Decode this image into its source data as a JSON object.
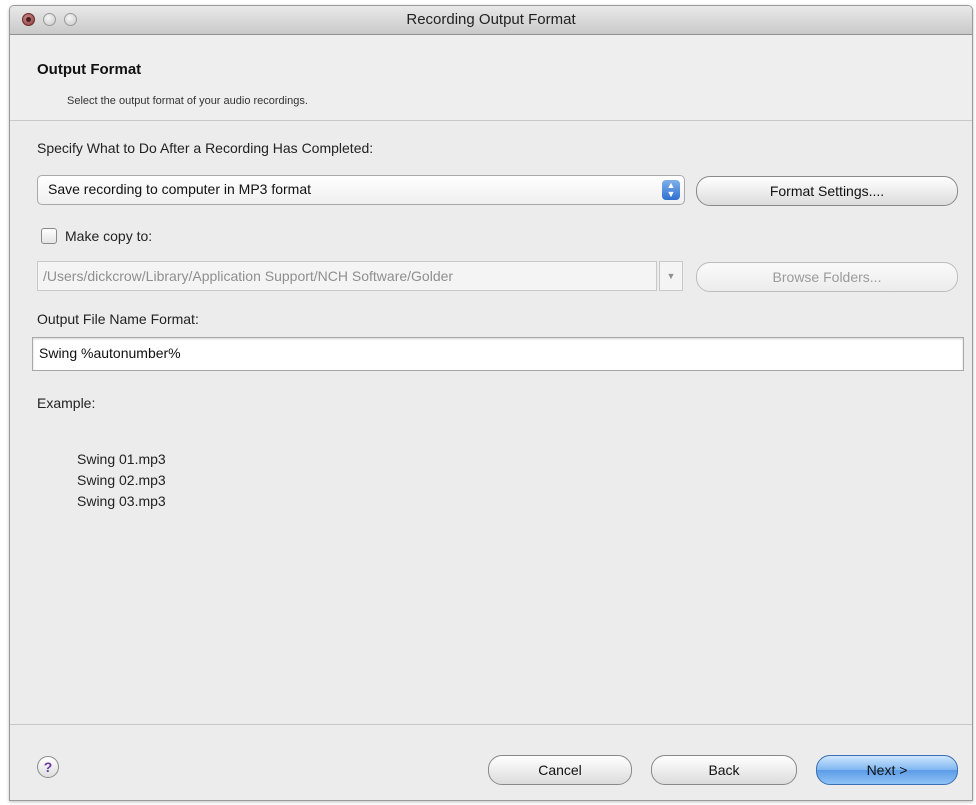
{
  "window": {
    "title": "Recording Output Format"
  },
  "header": {
    "title": "Output Format",
    "subtitle": "Select the output format of your audio recordings."
  },
  "after_recording": {
    "label": "Specify What to Do After a Recording Has Completed:",
    "selected_option": "Save recording to computer in MP3 format",
    "format_settings_label": "Format Settings...."
  },
  "copy": {
    "checkbox_label": "Make copy to:",
    "checked": false,
    "path_value": "/Users/dickcrow/Library/Application Support/NCH Software/Golder",
    "browse_label": "Browse Folders..."
  },
  "filename": {
    "label": "Output File Name Format:",
    "value": "Swing %autonumber%"
  },
  "example": {
    "label": "Example:",
    "lines": [
      "Swing 01.mp3",
      "Swing 02.mp3",
      "Swing 03.mp3"
    ]
  },
  "footer": {
    "help_glyph": "?",
    "cancel_label": "Cancel",
    "back_label": "Back",
    "next_label": "Next >"
  },
  "icons": {
    "select_arrows": "up-down-arrows-icon",
    "combo_arrow": "chevron-down-icon",
    "help": "help-icon"
  },
  "colors": {
    "primary_button": "#7fb6f0",
    "select_arrow": "#2f6fcf",
    "help_glyph": "#6a3aa0"
  }
}
